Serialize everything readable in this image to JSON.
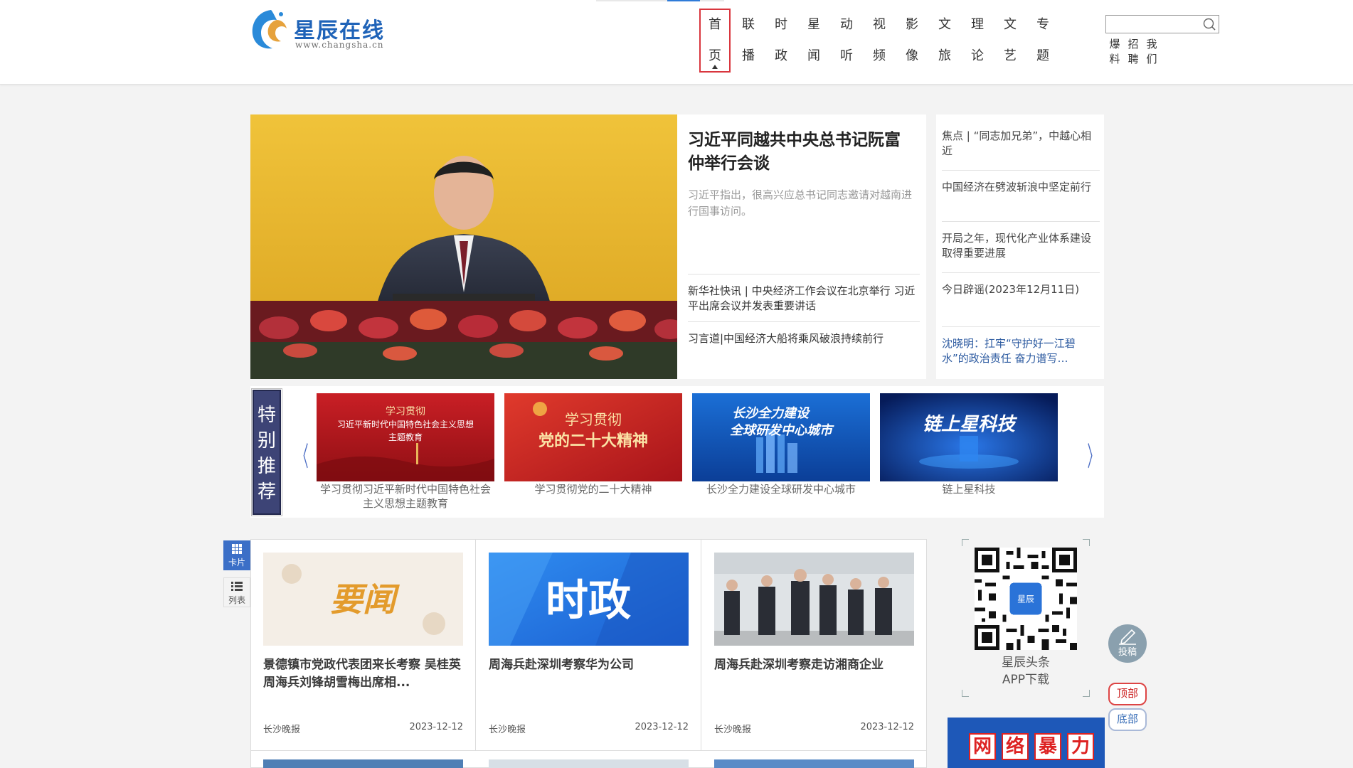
{
  "site": {
    "name": "星辰在线",
    "url": "www.changsha.cn"
  },
  "nav": [
    {
      "top": "首",
      "bottom": "页",
      "active": true
    },
    {
      "top": "联",
      "bottom": "播"
    },
    {
      "top": "时",
      "bottom": "政"
    },
    {
      "top": "星",
      "bottom": "闻"
    },
    {
      "top": "动",
      "bottom": "听"
    },
    {
      "top": "视",
      "bottom": "频"
    },
    {
      "top": "影",
      "bottom": "像"
    },
    {
      "top": "文",
      "bottom": "旅"
    },
    {
      "top": "理",
      "bottom": "论"
    },
    {
      "top": "文",
      "bottom": "艺"
    },
    {
      "top": "专",
      "bottom": "题"
    }
  ],
  "search": {
    "placeholder": "",
    "icon": "search-icon"
  },
  "quick_links": [
    {
      "top": "爆",
      "bottom": "料"
    },
    {
      "top": "招",
      "bottom": "聘"
    },
    {
      "top": "我",
      "bottom": "们"
    }
  ],
  "hero": {
    "title": "习近平同越共中央总书记阮富仲举行会谈",
    "description": "习近平指出，很高兴应总书记同志邀请对越南进行国事访问。",
    "links": [
      "新华社快讯 | 中央经济工作会议在北京举行 习近平出席会议并发表重要讲话",
      "习言道|中国经济大船将乘风破浪持续前行"
    ],
    "side": [
      "焦点 | “同志加兄弟”，中越心相近",
      "中国经济在劈波斩浪中坚定前行",
      "开局之年，现代化产业体系建设取得重要进展",
      "今日辟谣(2023年12月11日)",
      "沈晓明：扛牢“守护好一江碧水”的政治责任 奋力谱写…"
    ]
  },
  "special": {
    "label": [
      "特",
      "别",
      "推",
      "荐"
    ],
    "prev": "〈",
    "next": "〉",
    "items": [
      {
        "caption": "学习贯彻习近平新时代中国特色社会主义思想主题教育",
        "thumb_line1": "学习贯彻",
        "thumb_line2": "习近平新时代中国特色社会主义思想",
        "thumb_line3": "主题教育"
      },
      {
        "caption": "学习贯彻党的二十大精神",
        "thumb_line1": "学习贯彻",
        "thumb_line2": "党的二十大精神"
      },
      {
        "caption": "长沙全力建设全球研发中心城市",
        "thumb_line1": "长沙全力建设",
        "thumb_line2": "全球研发中心城市"
      },
      {
        "caption": "链上星科技",
        "thumb_line1": "链上星科技"
      }
    ]
  },
  "view_switch": {
    "card": "卡片",
    "list": "列表"
  },
  "cards": [
    {
      "thumb_text": "要闻",
      "title": "景德镇市党政代表团来长考察 吴桂英周海兵刘锋胡雪梅出席相...",
      "source": "长沙晚报",
      "date": "2023-12-12"
    },
    {
      "thumb_text": "时政",
      "title": "周海兵赴深圳考察华为公司",
      "source": "长沙晚报",
      "date": "2023-12-12"
    },
    {
      "thumb_text": "",
      "title": "周海兵赴深圳考察走访湘商企业",
      "source": "长沙晚报",
      "date": "2023-12-12"
    }
  ],
  "app": {
    "label1": "星辰头条",
    "label2": "APP下载"
  },
  "banner": {
    "chars": [
      "网",
      "络",
      "暴",
      "力"
    ]
  },
  "floating": {
    "submit": "投稿",
    "top": "顶部",
    "bottom": "底部"
  },
  "colors": {
    "accent": "#2f7bd8",
    "active_nav": "#d9363e",
    "special_label": "#3d4476"
  }
}
